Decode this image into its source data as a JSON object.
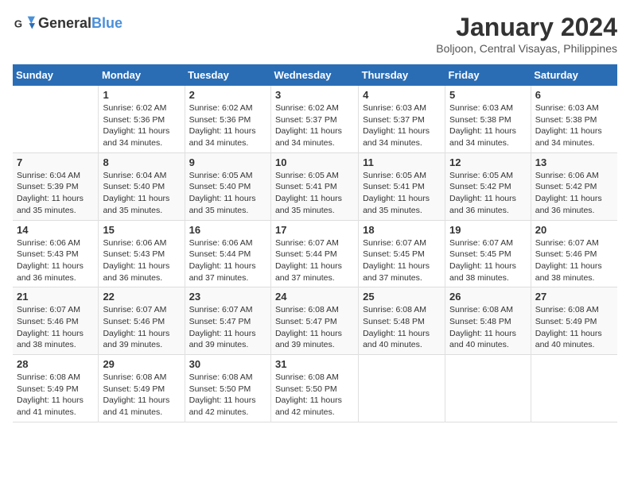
{
  "logo": {
    "line1": "General",
    "line2": "Blue"
  },
  "title": "January 2024",
  "location": "Boljoon, Central Visayas, Philippines",
  "days_of_week": [
    "Sunday",
    "Monday",
    "Tuesday",
    "Wednesday",
    "Thursday",
    "Friday",
    "Saturday"
  ],
  "weeks": [
    [
      {
        "day": "",
        "content": ""
      },
      {
        "day": "1",
        "content": "Sunrise: 6:02 AM\nSunset: 5:36 PM\nDaylight: 11 hours\nand 34 minutes."
      },
      {
        "day": "2",
        "content": "Sunrise: 6:02 AM\nSunset: 5:36 PM\nDaylight: 11 hours\nand 34 minutes."
      },
      {
        "day": "3",
        "content": "Sunrise: 6:02 AM\nSunset: 5:37 PM\nDaylight: 11 hours\nand 34 minutes."
      },
      {
        "day": "4",
        "content": "Sunrise: 6:03 AM\nSunset: 5:37 PM\nDaylight: 11 hours\nand 34 minutes."
      },
      {
        "day": "5",
        "content": "Sunrise: 6:03 AM\nSunset: 5:38 PM\nDaylight: 11 hours\nand 34 minutes."
      },
      {
        "day": "6",
        "content": "Sunrise: 6:03 AM\nSunset: 5:38 PM\nDaylight: 11 hours\nand 34 minutes."
      }
    ],
    [
      {
        "day": "7",
        "content": "Sunrise: 6:04 AM\nSunset: 5:39 PM\nDaylight: 11 hours\nand 35 minutes."
      },
      {
        "day": "8",
        "content": "Sunrise: 6:04 AM\nSunset: 5:40 PM\nDaylight: 11 hours\nand 35 minutes."
      },
      {
        "day": "9",
        "content": "Sunrise: 6:05 AM\nSunset: 5:40 PM\nDaylight: 11 hours\nand 35 minutes."
      },
      {
        "day": "10",
        "content": "Sunrise: 6:05 AM\nSunset: 5:41 PM\nDaylight: 11 hours\nand 35 minutes."
      },
      {
        "day": "11",
        "content": "Sunrise: 6:05 AM\nSunset: 5:41 PM\nDaylight: 11 hours\nand 35 minutes."
      },
      {
        "day": "12",
        "content": "Sunrise: 6:05 AM\nSunset: 5:42 PM\nDaylight: 11 hours\nand 36 minutes."
      },
      {
        "day": "13",
        "content": "Sunrise: 6:06 AM\nSunset: 5:42 PM\nDaylight: 11 hours\nand 36 minutes."
      }
    ],
    [
      {
        "day": "14",
        "content": "Sunrise: 6:06 AM\nSunset: 5:43 PM\nDaylight: 11 hours\nand 36 minutes."
      },
      {
        "day": "15",
        "content": "Sunrise: 6:06 AM\nSunset: 5:43 PM\nDaylight: 11 hours\nand 36 minutes."
      },
      {
        "day": "16",
        "content": "Sunrise: 6:06 AM\nSunset: 5:44 PM\nDaylight: 11 hours\nand 37 minutes."
      },
      {
        "day": "17",
        "content": "Sunrise: 6:07 AM\nSunset: 5:44 PM\nDaylight: 11 hours\nand 37 minutes."
      },
      {
        "day": "18",
        "content": "Sunrise: 6:07 AM\nSunset: 5:45 PM\nDaylight: 11 hours\nand 37 minutes."
      },
      {
        "day": "19",
        "content": "Sunrise: 6:07 AM\nSunset: 5:45 PM\nDaylight: 11 hours\nand 38 minutes."
      },
      {
        "day": "20",
        "content": "Sunrise: 6:07 AM\nSunset: 5:46 PM\nDaylight: 11 hours\nand 38 minutes."
      }
    ],
    [
      {
        "day": "21",
        "content": "Sunrise: 6:07 AM\nSunset: 5:46 PM\nDaylight: 11 hours\nand 38 minutes."
      },
      {
        "day": "22",
        "content": "Sunrise: 6:07 AM\nSunset: 5:46 PM\nDaylight: 11 hours\nand 39 minutes."
      },
      {
        "day": "23",
        "content": "Sunrise: 6:07 AM\nSunset: 5:47 PM\nDaylight: 11 hours\nand 39 minutes."
      },
      {
        "day": "24",
        "content": "Sunrise: 6:08 AM\nSunset: 5:47 PM\nDaylight: 11 hours\nand 39 minutes."
      },
      {
        "day": "25",
        "content": "Sunrise: 6:08 AM\nSunset: 5:48 PM\nDaylight: 11 hours\nand 40 minutes."
      },
      {
        "day": "26",
        "content": "Sunrise: 6:08 AM\nSunset: 5:48 PM\nDaylight: 11 hours\nand 40 minutes."
      },
      {
        "day": "27",
        "content": "Sunrise: 6:08 AM\nSunset: 5:49 PM\nDaylight: 11 hours\nand 40 minutes."
      }
    ],
    [
      {
        "day": "28",
        "content": "Sunrise: 6:08 AM\nSunset: 5:49 PM\nDaylight: 11 hours\nand 41 minutes."
      },
      {
        "day": "29",
        "content": "Sunrise: 6:08 AM\nSunset: 5:49 PM\nDaylight: 11 hours\nand 41 minutes."
      },
      {
        "day": "30",
        "content": "Sunrise: 6:08 AM\nSunset: 5:50 PM\nDaylight: 11 hours\nand 42 minutes."
      },
      {
        "day": "31",
        "content": "Sunrise: 6:08 AM\nSunset: 5:50 PM\nDaylight: 11 hours\nand 42 minutes."
      },
      {
        "day": "",
        "content": ""
      },
      {
        "day": "",
        "content": ""
      },
      {
        "day": "",
        "content": ""
      }
    ]
  ]
}
